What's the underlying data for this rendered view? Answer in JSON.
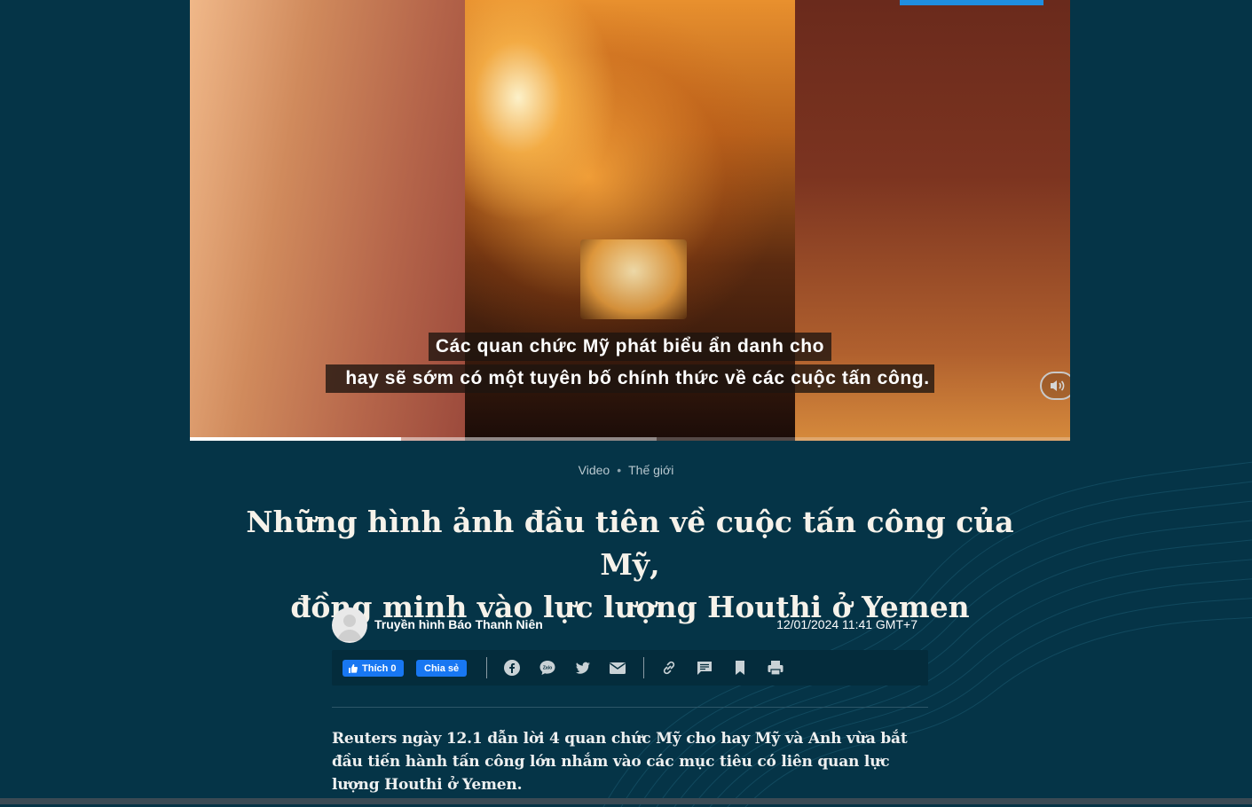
{
  "video": {
    "subtitle_line1": "Các quan chức Mỹ phát biểu ẩn danh cho",
    "subtitle_line2": "hay sẽ sớm có một tuyên bố chính thức về các cuộc tấn công.",
    "progress": 0.24,
    "buffered": 0.53,
    "sound_icon": "speaker-icon"
  },
  "breadcrumb": {
    "section": "Video",
    "category": "Thế giới"
  },
  "article": {
    "title_line1": "Những hình ảnh đầu tiên về cuộc tấn công của Mỹ,",
    "title_line2": "đồng minh vào lực lượng Houthi ở Yemen",
    "author": "Truyền hình Báo Thanh Niên",
    "date": "12/01/2024 11:41 GMT+7",
    "lead": "Reuters ngày 12.1 dẫn lời 4 quan chức Mỹ cho hay Mỹ và Anh vừa bắt đầu tiến hành tấn công lớn nhắm vào các mục tiêu có liên quan lực lượng Houthi ở Yemen."
  },
  "share": {
    "like_label": "Thích 0",
    "share_label": "Chia sẻ",
    "zalo_label": "Zalo",
    "icons": [
      "facebook-icon",
      "zalo-icon",
      "twitter-icon",
      "email-icon",
      "link-icon",
      "comment-icon",
      "bookmark-icon",
      "print-icon"
    ]
  },
  "colors": {
    "background": "#053447",
    "facebook": "#1877f2",
    "share_bar": "#042c3c"
  }
}
